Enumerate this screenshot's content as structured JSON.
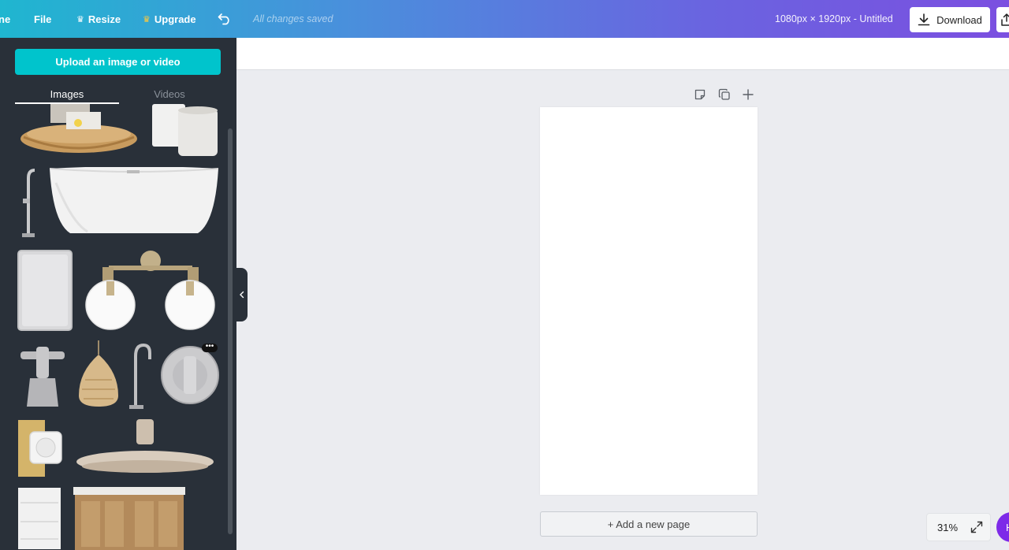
{
  "header": {
    "home_partial": "ne",
    "file_label": "File",
    "resize_label": "Resize",
    "upgrade_label": "Upgrade",
    "saved_status": "All changes saved",
    "dimensions_title": "1080px × 1920px - Untitled",
    "download_label": "Download"
  },
  "sidebar": {
    "upload_label": "Upload an image or video",
    "tabs": [
      {
        "label": "Images",
        "active": true
      },
      {
        "label": "Videos",
        "active": false
      }
    ],
    "more_label": "•••"
  },
  "canvas": {
    "add_page_label": "+ Add a new page"
  },
  "footer": {
    "zoom_label": "31%",
    "help_partial": "H"
  },
  "colors": {
    "accent_teal": "#00c4cc",
    "sidebar_bg": "#293039",
    "help_purple": "#7d2ae8"
  },
  "icons": [
    "crown-icon",
    "undo-icon",
    "download-icon",
    "share-icon",
    "note-icon",
    "duplicate-icon",
    "plus-icon",
    "chevron-left-icon",
    "expand-icon"
  ]
}
